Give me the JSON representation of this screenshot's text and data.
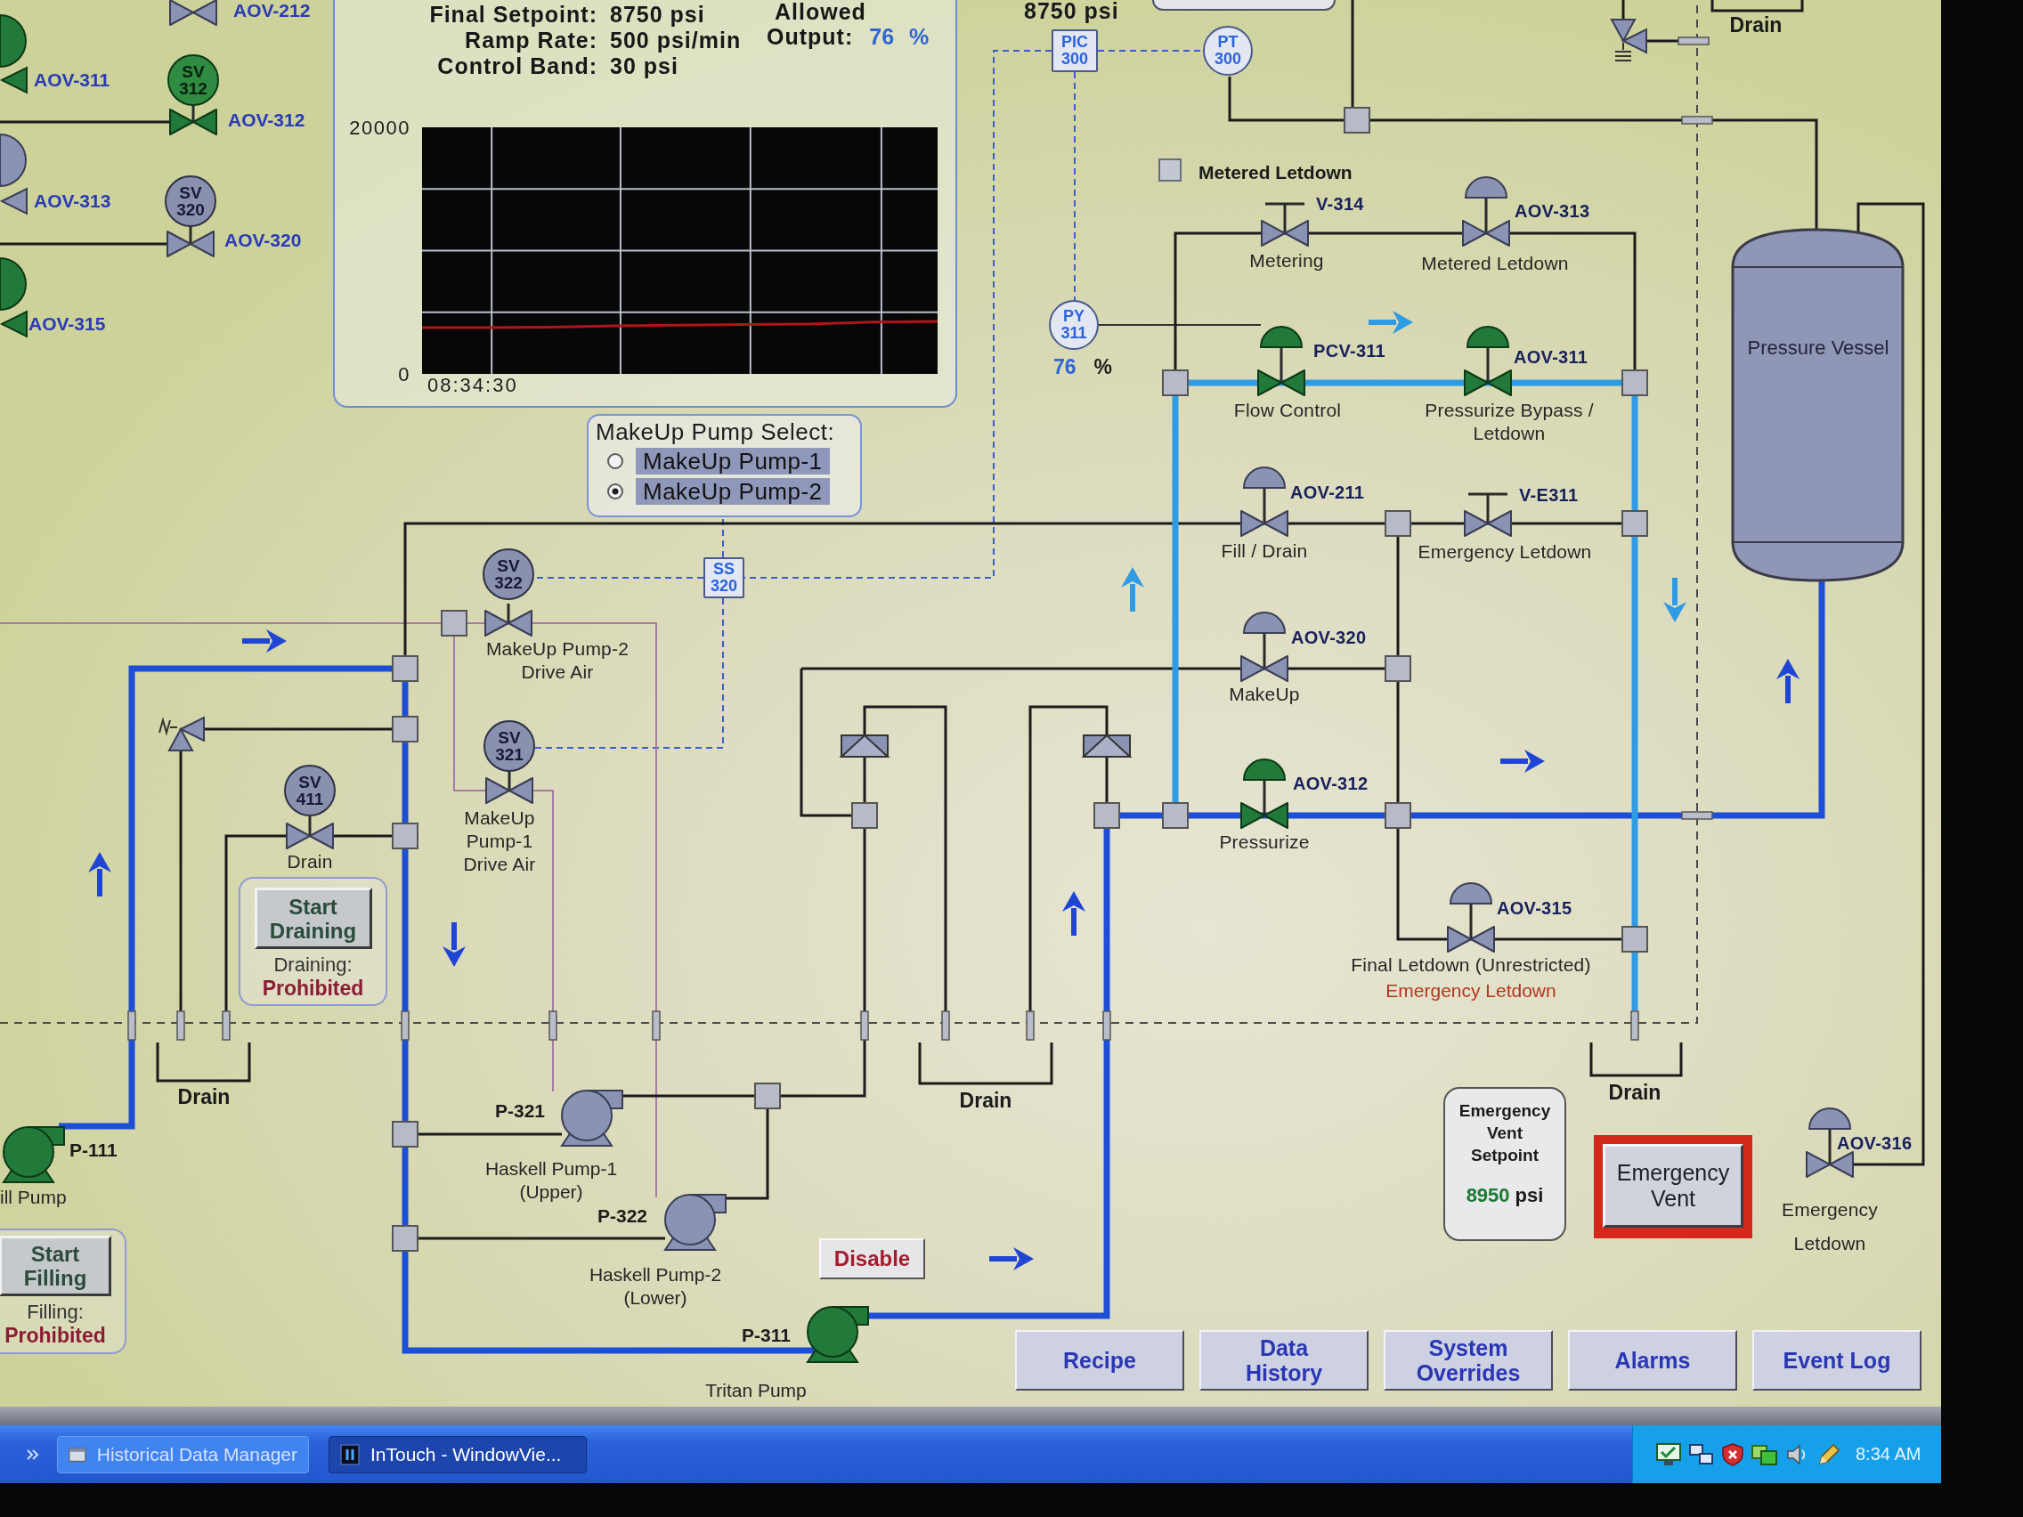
{
  "left_column": [
    {
      "tag": "AOV-212",
      "kind": "full",
      "open": false
    },
    {
      "tag": "AOV-311",
      "kind": "edge",
      "open": true
    },
    {
      "tag": "AOV-312",
      "kind": "full",
      "open": true,
      "solenoid": {
        "tag": "SV",
        "number": "312"
      }
    },
    {
      "tag": "AOV-313",
      "kind": "edge",
      "open": false
    },
    {
      "tag": "AOV-320",
      "kind": "full",
      "open": false,
      "solenoid": {
        "tag": "SV",
        "number": "320"
      }
    },
    {
      "tag": "AOV-315",
      "kind": "edge",
      "open": true
    }
  ],
  "trend_panel": {
    "cut_heading": "Allowed",
    "fields": [
      {
        "label": "Final Setpoint:",
        "value": "8750 psi"
      },
      {
        "label": "Ramp Rate:",
        "value": "500 psi/min"
      },
      {
        "label": "Control Band:",
        "value": "30 psi"
      }
    ],
    "output": {
      "label": "Output:",
      "value": "76",
      "unit": "%"
    },
    "chart_data": {
      "type": "line",
      "values": [
        3750,
        3750,
        3800,
        3900,
        3950,
        4000,
        4050,
        4200,
        4250
      ],
      "ylim": [
        0,
        20000
      ],
      "yticks": [
        {
          "value": 0,
          "label": "0"
        },
        {
          "value": 20000,
          "label": "20000"
        }
      ],
      "annotations": [
        "08:34:30"
      ]
    }
  },
  "header_reading": "8750 psi",
  "instruments": [
    {
      "tag": "PIC",
      "number": "300",
      "kind": "square"
    },
    {
      "tag": "PT",
      "number": "300",
      "kind": "circle"
    },
    {
      "tag": "PY",
      "number": "311",
      "kind": "circle",
      "reading": "76",
      "unit": "%"
    },
    {
      "tag": "SS",
      "number": "320",
      "kind": "square"
    }
  ],
  "metered_letdown": {
    "label": "Metered Letdown",
    "checked": false
  },
  "valves": [
    {
      "tag": "V-314",
      "kind": "manual",
      "open": false,
      "caption": [
        "Metering"
      ]
    },
    {
      "tag": "AOV-313",
      "kind": "actuated",
      "open": false,
      "caption": [
        "Metered Letdown"
      ]
    },
    {
      "tag": "PCV-311",
      "kind": "actuated",
      "open": true,
      "caption": [
        "Flow Control"
      ]
    },
    {
      "tag": "AOV-311",
      "kind": "actuated",
      "open": true,
      "caption": [
        "Pressurize Bypass /",
        "Letdown"
      ]
    },
    {
      "tag": "AOV-211",
      "kind": "actuated",
      "open": false,
      "caption": [
        "Fill / Drain"
      ]
    },
    {
      "tag": "V-E311",
      "kind": "manual",
      "open": false,
      "caption": [
        "Emergency Letdown"
      ]
    },
    {
      "tag": "AOV-320",
      "kind": "actuated",
      "open": false,
      "caption": [
        "MakeUp"
      ]
    },
    {
      "tag": "AOV-312",
      "kind": "actuated",
      "open": true,
      "caption": [
        "Pressurize"
      ]
    },
    {
      "tag": "AOV-315",
      "kind": "actuated",
      "open": false,
      "caption": [
        "Final Letdown (Unrestricted)"
      ],
      "alert": "Emergency Letdown"
    },
    {
      "tag": "AOV-316",
      "kind": "actuated",
      "open": false,
      "caption": [
        "Emergency",
        "Letdown"
      ]
    }
  ],
  "vessel": {
    "label": "Pressure Vessel"
  },
  "pump_select": {
    "title": "MakeUp Pump Select:",
    "options": [
      {
        "label": "MakeUp Pump-1",
        "selected": false
      },
      {
        "label": "MakeUp Pump-2",
        "selected": true
      }
    ]
  },
  "solenoid_valves": [
    {
      "tag": "SV",
      "number": "322",
      "open": false,
      "caption": [
        "MakeUp Pump-2",
        "Drive Air"
      ]
    },
    {
      "tag": "SV",
      "number": "411",
      "open": false,
      "caption": [
        "Drain"
      ]
    },
    {
      "tag": "SV",
      "number": "321",
      "open": false,
      "caption": [
        "MakeUp",
        "Pump-1",
        "Drive Air"
      ]
    }
  ],
  "drain_panel": {
    "button": [
      "Start",
      "Draining"
    ],
    "status_label": "Draining:",
    "status": "Prohibited"
  },
  "drain_labels": [
    "Drain",
    "Drain",
    "Drain",
    "Drain"
  ],
  "pumps": [
    {
      "tag": "P-111",
      "running": true,
      "caption": [
        "ill Pump"
      ]
    },
    {
      "tag": "P-321",
      "running": false,
      "caption": [
        "Haskell Pump-1",
        "(Upper)"
      ]
    },
    {
      "tag": "P-322",
      "running": false,
      "caption": [
        "Haskell Pump-2",
        "(Lower)"
      ]
    },
    {
      "tag": "P-311",
      "running": true,
      "caption": [
        "Tritan Pump"
      ]
    }
  ],
  "fill_panel": {
    "button": [
      "Start",
      "Filling"
    ],
    "status_label": "Filling:",
    "status": "Prohibited"
  },
  "disable_button": "Disable",
  "vent_setpoint": {
    "title": [
      "Emergency",
      "Vent",
      "Setpoint"
    ],
    "value": "8950",
    "unit": "psi"
  },
  "vent_button": [
    "Emergency",
    "Vent"
  ],
  "nav_buttons": [
    [
      "Recipe"
    ],
    [
      "Data",
      "History"
    ],
    [
      "System",
      "Overrides"
    ],
    [
      "Alarms"
    ],
    [
      "Event Log"
    ]
  ],
  "taskbar": {
    "tasks": [
      {
        "label": "Historical Data Manager",
        "selected": false
      },
      {
        "label": "InTouch - WindowVie...",
        "selected": true
      }
    ],
    "clock": "8:34 AM"
  }
}
